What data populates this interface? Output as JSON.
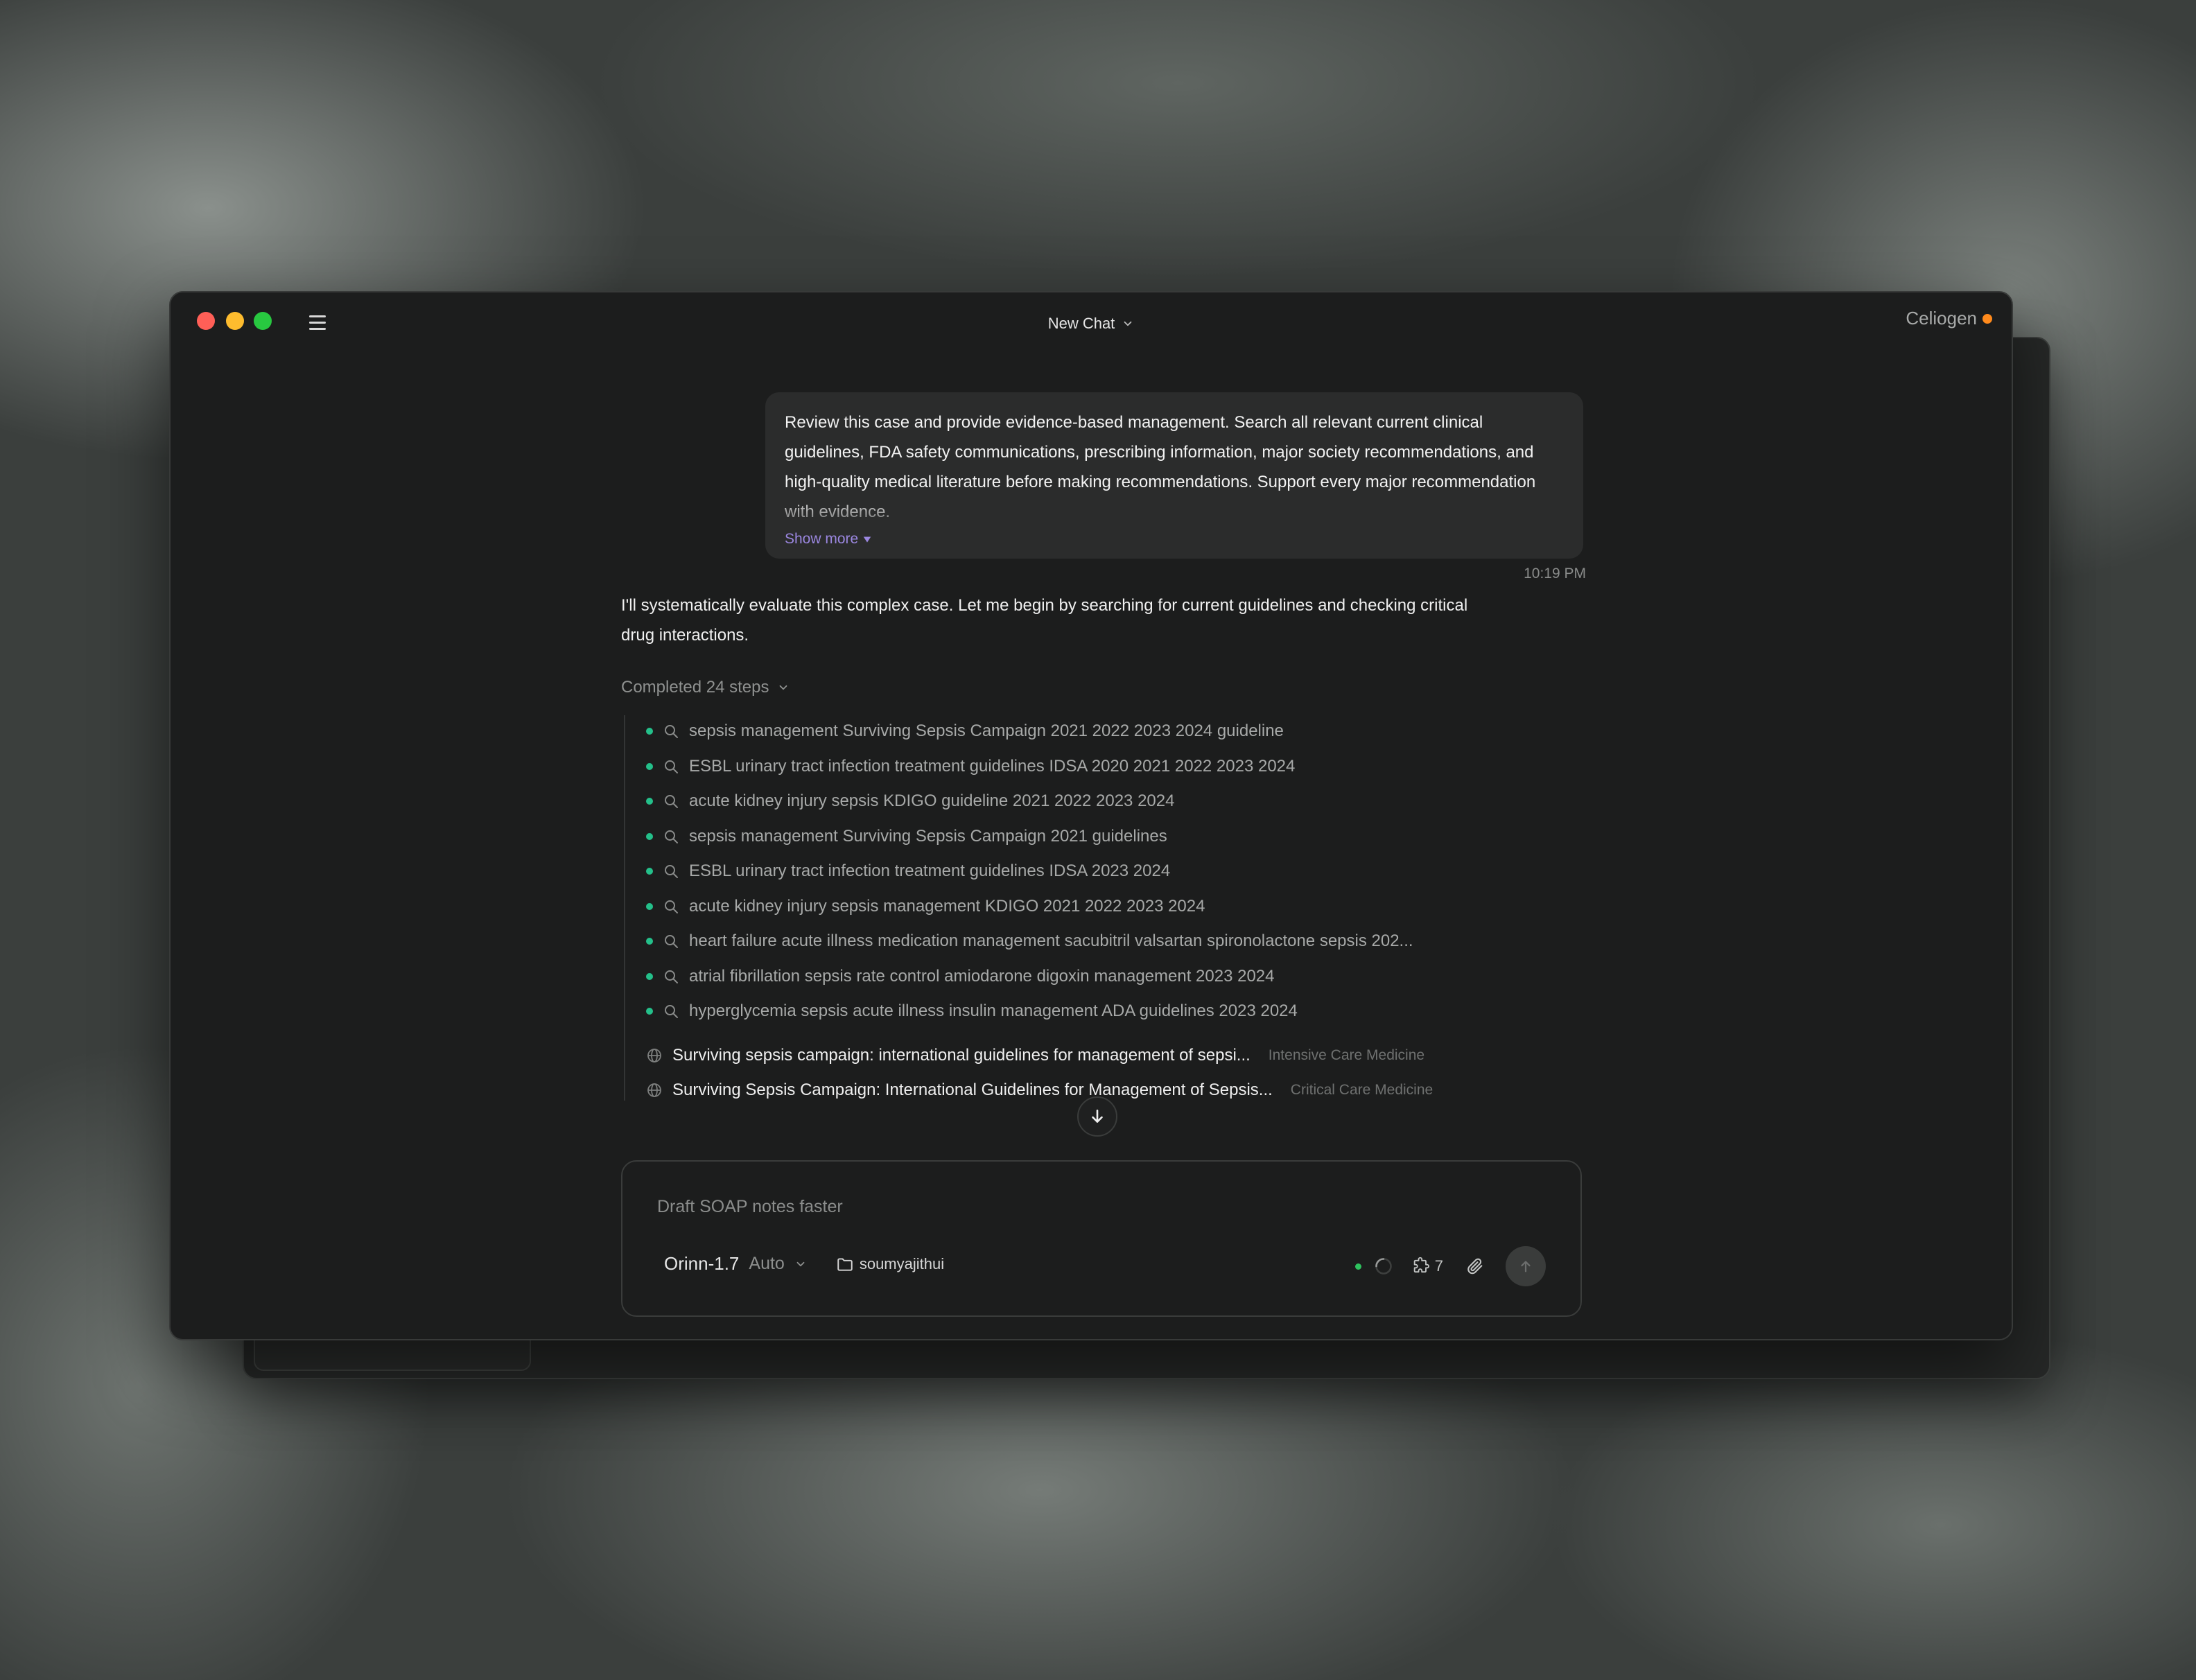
{
  "window": {
    "title": "New Chat",
    "brand": "Celiogen",
    "brand_status_color": "#ff8a1c"
  },
  "user_message": {
    "text": "Review this case and provide evidence-based management. Search all relevant current clinical guidelines, FDA safety communications, prescribing information, major society recommendations, and high-quality medical literature before making recommendations. Support every major recommendation with evidence.",
    "show_more_label": "Show more",
    "timestamp": "10:19 PM"
  },
  "assistant": {
    "text": "I'll systematically evaluate this complex case. Let me begin by searching for current guidelines and checking critical drug interactions.",
    "steps_label": "Completed 24 steps",
    "steps": [
      "sepsis management Surviving Sepsis Campaign 2021 2022 2023 2024 guideline",
      "ESBL urinary tract infection treatment guidelines IDSA 2020 2021 2022 2023 2024",
      "acute kidney injury sepsis KDIGO guideline 2021 2022 2023 2024",
      "sepsis management Surviving Sepsis Campaign 2021 guidelines",
      "ESBL urinary tract infection treatment guidelines IDSA 2023 2024",
      "acute kidney injury sepsis management KDIGO 2021 2022 2023 2024",
      "heart failure acute illness medication management sacubitril valsartan spironolactone sepsis 202...",
      "atrial fibrillation sepsis rate control amiodarone digoxin management 2023 2024",
      "hyperglycemia sepsis acute illness insulin management ADA guidelines 2023 2024"
    ],
    "sources": [
      {
        "title": "Surviving sepsis campaign: international guidelines for management of sepsi...",
        "journal": "Intensive Care Medicine"
      },
      {
        "title": "Surviving Sepsis Campaign: International Guidelines for Management of Sepsis...",
        "journal": "Critical Care Medicine"
      }
    ]
  },
  "composer": {
    "placeholder": "Draft SOAP notes faster",
    "value": "",
    "model": "Orinn-1.7",
    "mode": "Auto",
    "folder": "soumyajithui",
    "tools_count": "7"
  },
  "icons": {
    "step": "search-icon",
    "source": "globe-icon",
    "scroll": "arrow-down-icon",
    "folder": "folder-icon",
    "tools": "puzzle-icon",
    "attach": "paperclip-icon",
    "send": "arrow-up-icon"
  }
}
